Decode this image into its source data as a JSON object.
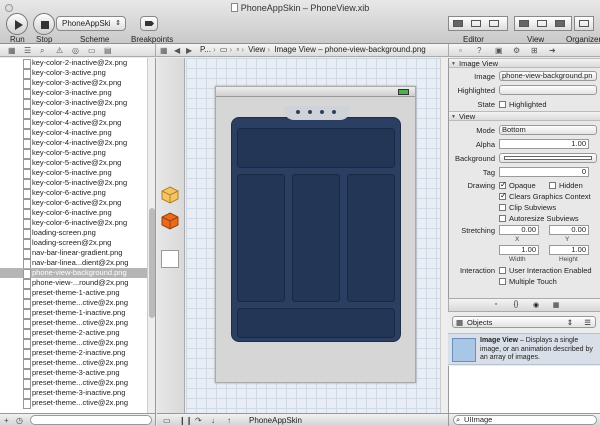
{
  "window": {
    "title": "PhoneAppSkin – PhoneView.xib"
  },
  "toolbar": {
    "run_label": "Run",
    "stop_label": "Stop",
    "scheme_label": "Scheme",
    "scheme_value": "PhoneAppSki",
    "breakpoints_label": "Breakpoints",
    "editor_label": "Editor",
    "view_label": "View",
    "organizer_label": "Organizer"
  },
  "jumpbar": {
    "crumbs": [
      "P...",
      "",
      "",
      "View",
      "Image View – phone-view-background.png"
    ]
  },
  "navigator": {
    "files": [
      "key-color-2-inactive@2x.png",
      "key-color-3-active.png",
      "key-color-3-active@2x.png",
      "key-color-3-inactive.png",
      "key-color-3-inactive@2x.png",
      "key-color-4-active.png",
      "key-color-4-active@2x.png",
      "key-color-4-inactive.png",
      "key-color-4-inactive@2x.png",
      "key-color-5-active.png",
      "key-color-5-active@2x.png",
      "key-color-5-inactive.png",
      "key-color-5-inactive@2x.png",
      "key-color-6-active.png",
      "key-color-6-active@2x.png",
      "key-color-6-inactive.png",
      "key-color-6-inactive@2x.png",
      "loading-screen.png",
      "loading-screen@2x.png",
      "nav-bar-linear-gradient.png",
      "nav-bar-linea...dient@2x.png",
      "phone-view-background.png",
      "phone-view-...round@2x.png",
      "preset-theme-1-active.png",
      "preset-theme...ctive@2x.png",
      "preset-theme-1-inactive.png",
      "preset-theme...ctive@2x.png",
      "preset-theme-2-active.png",
      "preset-theme...ctive@2x.png",
      "preset-theme-2-inactive.png",
      "preset-theme...ctive@2x.png",
      "preset-theme-3-active.png",
      "preset-theme...ctive@2x.png",
      "preset-theme-3-inactive.png",
      "preset-theme...ctive@2x.png"
    ],
    "selected_index": 21
  },
  "inspector": {
    "image_view_header": "Image View",
    "image_label": "Image",
    "image_value": "phone-view-background.pn",
    "highlighted_label": "Highlighted",
    "highlighted_value": "",
    "state_label": "State",
    "state_highlighted": "Highlighted",
    "view_header": "View",
    "mode_label": "Mode",
    "mode_value": "Bottom",
    "alpha_label": "Alpha",
    "alpha_value": "1.00",
    "background_label": "Background",
    "tag_label": "Tag",
    "tag_value": "0",
    "drawing_label": "Drawing",
    "opaque": "Opaque",
    "hidden": "Hidden",
    "clears_graphics": "Clears Graphics Context",
    "clip_subviews": "Clip Subviews",
    "autoresize_subviews": "Autoresize Subviews",
    "stretching_label": "Stretching",
    "stretch_x": "0.00",
    "stretch_y": "0.00",
    "x_label": "X",
    "y_label": "Y",
    "stretch_w": "1.00",
    "stretch_h": "1.00",
    "width_label": "Width",
    "height_label": "Height",
    "interaction_label": "Interaction",
    "user_interaction": "User Interaction Enabled",
    "multiple_touch": "Multiple Touch"
  },
  "library": {
    "filter_value": "Objects",
    "item_title": "Image View",
    "item_desc": " – Displays a single image, or an animation described by an array of images.",
    "search_value": "UIImage"
  },
  "bottom": {
    "debug_label": "PhoneAppSkin"
  },
  "colors": {
    "phone_background": "#2b3f63",
    "selection": "#b5b5b5"
  }
}
